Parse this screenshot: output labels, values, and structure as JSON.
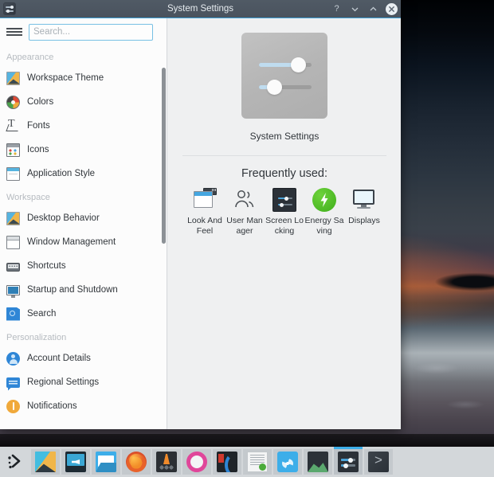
{
  "window": {
    "title": "System Settings",
    "app_icon": "system-settings-icon",
    "buttons": {
      "help": "?",
      "minimize": "minimize-icon",
      "maximize": "maximize-icon",
      "close": "close-icon"
    }
  },
  "search": {
    "value": "",
    "placeholder": "Search...",
    "menu_icon": "hamburger-icon"
  },
  "sidebar": {
    "sections": [
      {
        "label": "Appearance",
        "items": [
          {
            "label": "Workspace Theme",
            "icon": "wallpaper-icon"
          },
          {
            "label": "Colors",
            "icon": "color-wheel-icon"
          },
          {
            "label": "Fonts",
            "icon": "font-icon"
          },
          {
            "label": "Icons",
            "icon": "icons-grid-icon"
          },
          {
            "label": "Application Style",
            "icon": "application-window-icon"
          }
        ]
      },
      {
        "label": "Workspace",
        "items": [
          {
            "label": "Desktop Behavior",
            "icon": "wallpaper-icon"
          },
          {
            "label": "Window Management",
            "icon": "window-icon"
          },
          {
            "label": "Shortcuts",
            "icon": "keyboard-icon"
          },
          {
            "label": "Startup and Shutdown",
            "icon": "monitor-icon"
          },
          {
            "label": "Search",
            "icon": "search-document-icon"
          }
        ]
      },
      {
        "label": "Personalization",
        "items": [
          {
            "label": "Account Details",
            "icon": "user-avatar-icon"
          },
          {
            "label": "Regional Settings",
            "icon": "speech-bubble-icon"
          },
          {
            "label": "Notifications",
            "icon": "notification-bell-icon"
          }
        ]
      }
    ]
  },
  "main": {
    "hero": {
      "icon": "system-settings-sliders-icon",
      "title": "System Settings"
    },
    "frequently_used": {
      "heading": "Frequently used:",
      "items": [
        {
          "label": "Look And Feel",
          "icon": "look-and-feel-icon"
        },
        {
          "label": "User Manager",
          "icon": "user-manager-icon"
        },
        {
          "label": "Screen Locking",
          "icon": "screen-locking-icon"
        },
        {
          "label": "Energy Saving",
          "icon": "energy-saving-icon"
        },
        {
          "label": "Displays",
          "icon": "displays-icon"
        }
      ]
    }
  },
  "panel": {
    "launcher": {
      "label": "Application Launcher",
      "icon": "kde-logo-icon"
    },
    "tasks": [
      {
        "name": "wallpaper-app",
        "icon": "wallpaper-icon",
        "active": false
      },
      {
        "name": "display-app",
        "icon": "monitor-icon",
        "active": false
      },
      {
        "name": "file-manager",
        "icon": "folder-icon",
        "active": false
      },
      {
        "name": "firefox",
        "icon": "firefox-icon",
        "active": false
      },
      {
        "name": "vlc",
        "icon": "vlc-cone-icon",
        "active": false
      },
      {
        "name": "ring-app",
        "icon": "ring-icon",
        "active": false
      },
      {
        "name": "kate",
        "icon": "kate-icon",
        "active": false
      },
      {
        "name": "document-app",
        "icon": "document-icon",
        "active": false
      },
      {
        "name": "discover",
        "icon": "discover-bag-icon",
        "active": false
      },
      {
        "name": "image-viewer",
        "icon": "image-viewer-icon",
        "active": false
      },
      {
        "name": "system-settings",
        "icon": "system-settings-sliders-icon",
        "active": true
      },
      {
        "name": "terminal",
        "icon": "terminal-prompt-icon",
        "active": false
      }
    ]
  },
  "colors": {
    "titlebar": "#4d5762",
    "accent": "#3daee9",
    "sidebar_bg": "#fcfcfc",
    "main_bg": "#eff0f1",
    "panel_bg": "#d3d7da",
    "text": "#31363b",
    "section_label": "#b6bbc0"
  }
}
